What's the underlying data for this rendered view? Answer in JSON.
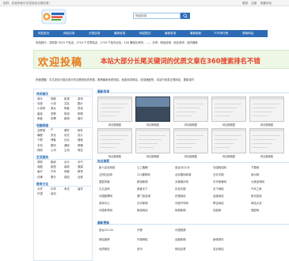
{
  "topbar": {
    "welcome": "您好，欢迎来到中文发包站分类目录！",
    "links": [
      "登录",
      "注册",
      "收藏本站"
    ]
  },
  "search": {
    "value": "网站收录"
  },
  "nav": [
    "网站首页",
    "网站目录",
    "分类目录",
    "最新收录",
    "网站提交",
    "最新收录",
    "最新更新",
    "TOP排行榜",
    "搜索网站"
  ],
  "notice": "本站统计：共收录 1523 个站点，2724 个文章站点，1724 个站外点击，154 篇站长资讯，…… 分享：网站目录 · 站长资讯 · 站内搜索",
  "banner": {
    "welcome": "欢迎投稿",
    "slogan": "本站大部分长尾关键词的优质文章在360搜索排名不错"
  },
  "intro": "快速提醒：中文发包分类目录分享互联网优质资源，推荐最新优质网站，免费收录网站，收录速度快，本站只收录正规网站，更新及时",
  "sidebar": {
    "sections": [
      {
        "title": "休闲娱乐",
        "items": [
          "音乐",
          "视频",
          "影视",
          "游戏",
          "动漫",
          "小说",
          "交友",
          "图片",
          "小游戏",
          "美女",
          "明星",
          "笑话",
          "星座",
          "宠物",
          "旅游",
          "购物",
          "美食",
          "彩票",
          "新闻",
          "娱乐"
        ]
      },
      {
        "title": "电脑网络",
        "items": [
          "互联网",
          "IT",
          "硬件",
          "软件",
          "编程",
          "安全",
          "站长",
          "设计",
          "下载",
          "博客",
          "论坛",
          "搜索",
          "手机",
          "数码",
          "通信",
          "邮箱",
          "网络",
          "公司",
          "主机",
          "域名"
        ]
      },
      {
        "title": "生活服务",
        "items": [
          "求职",
          "租房",
          "出行",
          "天气",
          "地图",
          "家居",
          "装修",
          "健康",
          "医疗",
          "汽车",
          "母婴",
          "教育",
          "法律",
          "银行",
          "保险",
          "证券"
        ]
      },
      {
        "title": "教育文化",
        "items": [
          "大学",
          "中学",
          "考试",
          "留学",
          "外语",
          "培训"
        ]
      }
    ]
  },
  "latest": {
    "title": "最新收录",
    "thumbs": [
      "网站缩略图",
      "网站缩略图",
      "网站缩略图",
      "网站缩略图",
      "网站缩略图",
      "网站缩略图",
      "网站缩略图",
      "网站缩略图",
      "网站缩略图",
      "网站缩略图"
    ]
  },
  "ranking": {
    "title": "站点推荐",
    "cells": [
      "新人站长网络",
      "土工格栅",
      "泉台分口CN",
      "中国网站网",
      "下载网",
      "云阳社区网",
      "123建筑网",
      "北京国际新闻",
      "天天中国",
      "泉州网",
      "搜狐传媒",
      "新浪新闻",
      "天美娱乐网",
      "中华美食网",
      "大美游戏网",
      "久久游戏",
      "美食天下",
      "乐游中国",
      "天下网络",
      "汽车之家",
      "中国股票网",
      "厦门信息港",
      "好搜网站",
      "百度网站",
      "阳光旅游",
      "游戏中心",
      "天天新闻",
      "中国汽车网",
      "联合网站",
      "网站大全",
      "中国体育网",
      "新浪网站",
      "网易新闻",
      "凤凰网",
      "搜狐网"
    ]
  },
  "bottom": {
    "title": "最新更新",
    "rows": [
      [
        "泉台CD.CN",
        "开源",
        "中国视频"
      ],
      [
        "网站推荐",
        "开源网络",
        "百度新闻",
        "新闻资讯"
      ],
      [
        "优质网站",
        "资讯",
        "网站目录",
        "站长网站"
      ]
    ]
  },
  "colors": {
    "nav": "#2d6cb5",
    "banner_bg": "#eef7e5",
    "welcome": "#e67a1a",
    "slogan": "#e63f25"
  }
}
